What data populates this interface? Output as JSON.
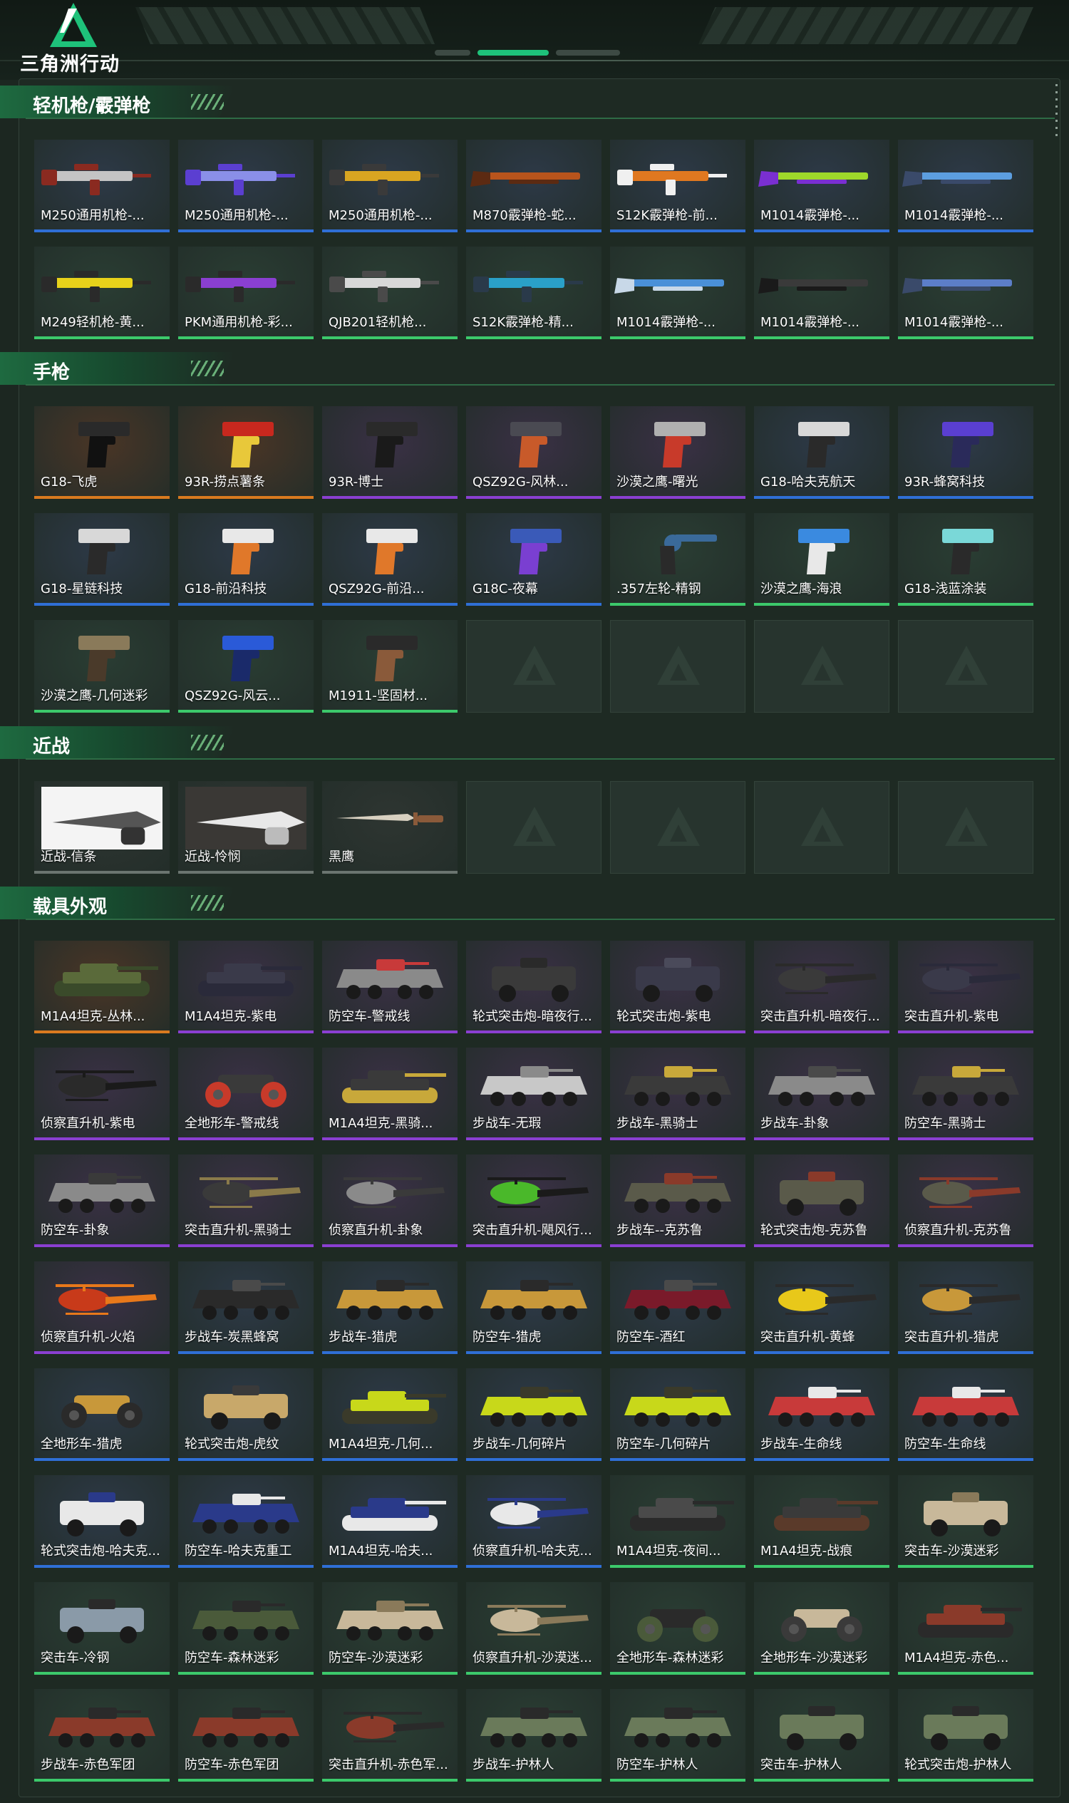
{
  "header": {
    "logo_text": "三角洲行动",
    "colors": {
      "accent": "#1ec27a",
      "brand_green": "#1e6a40"
    }
  },
  "rarity_colors": {
    "orange": "#d97a1f",
    "purple": "#8a3fd1",
    "blue": "#2f6fd6",
    "green": "#3cc96b",
    "gray": "#6b7570"
  },
  "sections": {
    "lmg": {
      "title": "轻机枪/霰弹枪",
      "items": [
        {
          "name": "M250通用机枪-...",
          "rarity": "blue",
          "kind": "rifle",
          "colors": [
            "#c4c4c4",
            "#8a2a20"
          ]
        },
        {
          "name": "M250通用机枪-...",
          "rarity": "blue",
          "kind": "rifle",
          "colors": [
            "#8a8fe8",
            "#5b3fd1"
          ]
        },
        {
          "name": "M250通用机枪-...",
          "rarity": "blue",
          "kind": "rifle",
          "colors": [
            "#d9a521",
            "#3a3a3a"
          ]
        },
        {
          "name": "M870霰弹枪-蛇...",
          "rarity": "blue",
          "kind": "shotgun",
          "colors": [
            "#b8541c",
            "#5c2a12"
          ]
        },
        {
          "name": "S12K霰弹枪-前...",
          "rarity": "blue",
          "kind": "rifle",
          "colors": [
            "#e07820",
            "#f0f0f0"
          ]
        },
        {
          "name": "M1014霰弹枪-...",
          "rarity": "blue",
          "kind": "shotgun",
          "colors": [
            "#9ed82a",
            "#7a2fd1"
          ]
        },
        {
          "name": "M1014霰弹枪-...",
          "rarity": "blue",
          "kind": "shotgun",
          "colors": [
            "#5c9ee0",
            "#3a4a6a"
          ]
        },
        {
          "name": "M249轻机枪-黄...",
          "rarity": "green",
          "kind": "rifle",
          "colors": [
            "#e8d21a",
            "#2a2a2a"
          ]
        },
        {
          "name": "PKM通用机枪-彩...",
          "rarity": "green",
          "kind": "rifle",
          "colors": [
            "#8a3fd1",
            "#2a2a2a"
          ]
        },
        {
          "name": "QJB201轻机枪...",
          "rarity": "green",
          "kind": "rifle",
          "colors": [
            "#d8d8d8",
            "#4a4a4a"
          ]
        },
        {
          "name": "S12K霰弹枪-精...",
          "rarity": "green",
          "kind": "rifle",
          "colors": [
            "#2aa0c8",
            "#2a3a4a"
          ]
        },
        {
          "name": "M1014霰弹枪-...",
          "rarity": "green",
          "kind": "shotgun",
          "colors": [
            "#4a90d8",
            "#c8d8e8"
          ]
        },
        {
          "name": "M1014霰弹枪-...",
          "rarity": "green",
          "kind": "shotgun",
          "colors": [
            "#3a3a3a",
            "#1a1a1a"
          ]
        },
        {
          "name": "M1014霰弹枪-...",
          "rarity": "green",
          "kind": "shotgun",
          "colors": [
            "#5c7ec8",
            "#3a4a6a"
          ]
        }
      ]
    },
    "pistol": {
      "title": "手枪",
      "items": [
        {
          "name": "G18-飞虎",
          "rarity": "orange",
          "kind": "pistol",
          "colors": [
            "#2a2a2a",
            "#111111"
          ]
        },
        {
          "name": "93R-捞点薯条",
          "rarity": "orange",
          "kind": "pistol",
          "colors": [
            "#c8281e",
            "#e8c83a"
          ]
        },
        {
          "name": "93R-博士",
          "rarity": "purple",
          "kind": "pistol",
          "colors": [
            "#2a2a2a",
            "#1a1a1a"
          ]
        },
        {
          "name": "QSZ92G-风林...",
          "rarity": "purple",
          "kind": "pistol",
          "colors": [
            "#4a4a52",
            "#c85a2a"
          ]
        },
        {
          "name": "沙漠之鹰-曙光",
          "rarity": "purple",
          "kind": "pistol",
          "colors": [
            "#b0b0b0",
            "#c83a2a"
          ]
        },
        {
          "name": "G18-哈夫克航天",
          "rarity": "blue",
          "kind": "pistol",
          "colors": [
            "#d8d8d8",
            "#2a2a2a"
          ]
        },
        {
          "name": "93R-蜂窝科技",
          "rarity": "blue",
          "kind": "pistol",
          "colors": [
            "#5a3fd1",
            "#2a2a5a"
          ]
        },
        {
          "name": "G18-星链科技",
          "rarity": "blue",
          "kind": "pistol",
          "colors": [
            "#d8d8d8",
            "#2a2a2a"
          ]
        },
        {
          "name": "G18-前沿科技",
          "rarity": "blue",
          "kind": "pistol",
          "colors": [
            "#e8e8e8",
            "#e0782a"
          ]
        },
        {
          "name": "QSZ92G-前沿...",
          "rarity": "blue",
          "kind": "pistol",
          "colors": [
            "#e8e8e8",
            "#e0782a"
          ]
        },
        {
          "name": "G18C-夜幕",
          "rarity": "blue",
          "kind": "pistol",
          "colors": [
            "#3a5ab8",
            "#7a3fd1"
          ]
        },
        {
          ".name": "",
          "name": ".357左轮-精钢",
          "rarity": "green",
          "kind": "revolver",
          "colors": [
            "#3a6a9a",
            "#2a2a2a"
          ]
        },
        {
          "name": "沙漠之鹰-海浪",
          "rarity": "green",
          "kind": "pistol",
          "colors": [
            "#3a8ae0",
            "#e8e8e8"
          ]
        },
        {
          "name": "G18-浅蓝涂装",
          "rarity": "green",
          "kind": "pistol",
          "colors": [
            "#7ad8d8",
            "#2a2a2a"
          ]
        },
        {
          "name": "沙漠之鹰-几何迷彩",
          "rarity": "green",
          "kind": "pistol",
          "colors": [
            "#8a7a5a",
            "#4a3a2a"
          ]
        },
        {
          "name": "QSZ92G-风云...",
          "rarity": "green",
          "kind": "pistol",
          "colors": [
            "#2a5ad8",
            "#1a2a6a"
          ]
        },
        {
          "name": "M1911-坚固材...",
          "rarity": "green",
          "kind": "pistol",
          "colors": [
            "#2a2a2a",
            "#8a5a3a"
          ]
        },
        {
          "empty": true
        },
        {
          "empty": true
        },
        {
          "empty": true
        },
        {
          "empty": true
        }
      ]
    },
    "melee": {
      "title": "近战",
      "items": [
        {
          "name": "近战-信条",
          "rarity": "gray",
          "kind": "photo",
          "photo": "light"
        },
        {
          "name": "近战-怜悯",
          "rarity": "gray",
          "kind": "photo",
          "photo": "dark"
        },
        {
          "name": "黑鹰",
          "rarity": "gray",
          "kind": "knife",
          "colors": [
            "#d8d0c0",
            "#8a5a3a"
          ]
        },
        {
          "empty": true
        },
        {
          "empty": true
        },
        {
          "empty": true
        },
        {
          "empty": true
        }
      ]
    },
    "vehicle": {
      "title": "载具外观",
      "items": [
        {
          "name": "M1A4坦克-丛林...",
          "rarity": "orange",
          "kind": "tank",
          "colors": [
            "#5a6a3a",
            "#3a4a2a"
          ]
        },
        {
          "name": "M1A4坦克-紫电",
          "rarity": "purple",
          "kind": "tank",
          "colors": [
            "#3a3a4a",
            "#2a2a3a"
          ]
        },
        {
          "name": "防空车-警戒线",
          "rarity": "purple",
          "kind": "apc",
          "colors": [
            "#8a8a8a",
            "#c83a3a"
          ]
        },
        {
          "name": "轮式突击炮-暗夜行...",
          "rarity": "purple",
          "kind": "truck",
          "colors": [
            "#3a3a3a",
            "#2a2a2a"
          ]
        },
        {
          "name": "轮式突击炮-紫电",
          "rarity": "purple",
          "kind": "truck",
          "colors": [
            "#3a3a4a",
            "#4a4a5a"
          ]
        },
        {
          "name": "突击直升机-暗夜行...",
          "rarity": "purple",
          "kind": "heli",
          "colors": [
            "#3a3a3a",
            "#2a2a2a"
          ]
        },
        {
          "name": "突击直升机-紫电",
          "rarity": "purple",
          "kind": "heli",
          "colors": [
            "#3a3a4a",
            "#2a2a3a"
          ]
        },
        {
          "name": "侦察直升机-紫电",
          "rarity": "purple",
          "kind": "heli",
          "colors": [
            "#2a2a2a",
            "#1a1a1a"
          ]
        },
        {
          "name": "全地形车-警戒线",
          "rarity": "purple",
          "kind": "atv",
          "colors": [
            "#3a3a3a",
            "#c83a2a"
          ]
        },
        {
          "name": "M1A4坦克-黑骑...",
          "rarity": "purple",
          "kind": "tank",
          "colors": [
            "#3a3a3a",
            "#c8a83a"
          ]
        },
        {
          "name": "步战车-无瑕",
          "rarity": "purple",
          "kind": "apc",
          "colors": [
            "#c8c8c8",
            "#8a8a8a"
          ]
        },
        {
          "name": "步战车-黑骑士",
          "rarity": "purple",
          "kind": "apc",
          "colors": [
            "#3a3a3a",
            "#c8a83a"
          ]
        },
        {
          "name": "步战车-卦象",
          "rarity": "purple",
          "kind": "apc",
          "colors": [
            "#8a8a8a",
            "#4a4a4a"
          ]
        },
        {
          "name": "防空车-黑骑士",
          "rarity": "purple",
          "kind": "apc",
          "colors": [
            "#3a3a3a",
            "#c8a83a"
          ]
        },
        {
          "name": "防空车-卦象",
          "rarity": "purple",
          "kind": "apc",
          "colors": [
            "#8a8a8a",
            "#3a3a3a"
          ]
        },
        {
          "name": "突击直升机-黑骑士",
          "rarity": "purple",
          "kind": "heli",
          "colors": [
            "#3a3a3a",
            "#8a7a4a"
          ]
        },
        {
          "name": "侦察直升机-卦象",
          "rarity": "purple",
          "kind": "heli",
          "colors": [
            "#8a8a8a",
            "#3a3a3a"
          ]
        },
        {
          "name": "突击直升机-飓风行...",
          "rarity": "purple",
          "kind": "heli",
          "colors": [
            "#4ab82a",
            "#1a1a1a"
          ]
        },
        {
          "name": "步战车--克苏鲁",
          "rarity": "purple",
          "kind": "apc",
          "colors": [
            "#5a5a4a",
            "#8a3a2a"
          ]
        },
        {
          "name": "轮式突击炮-克苏鲁",
          "rarity": "purple",
          "kind": "truck",
          "colors": [
            "#5a5a4a",
            "#8a3a2a"
          ]
        },
        {
          "name": "侦察直升机-克苏鲁",
          "rarity": "purple",
          "kind": "heli",
          "colors": [
            "#5a5a4a",
            "#8a3a2a"
          ]
        },
        {
          "name": "侦察直升机-火焰",
          "rarity": "purple",
          "kind": "heli",
          "colors": [
            "#c83a1a",
            "#e8781a"
          ]
        },
        {
          "name": "步战车-炭黑蜂窝",
          "rarity": "blue",
          "kind": "apc",
          "colors": [
            "#2a2a2a",
            "#4a4a4a"
          ]
        },
        {
          "name": "步战车-猎虎",
          "rarity": "blue",
          "kind": "apc",
          "colors": [
            "#c8983a",
            "#2a2a2a"
          ]
        },
        {
          "name": "防空车-猎虎",
          "rarity": "blue",
          "kind": "apc",
          "colors": [
            "#c8983a",
            "#2a2a2a"
          ]
        },
        {
          "name": "防空车-酒红",
          "rarity": "blue",
          "kind": "apc",
          "colors": [
            "#7a1a2a",
            "#4a4a4a"
          ]
        },
        {
          "name": "突击直升机-黄蜂",
          "rarity": "blue",
          "kind": "heli",
          "colors": [
            "#e8c81a",
            "#2a2a2a"
          ]
        },
        {
          "name": "突击直升机-猎虎",
          "rarity": "blue",
          "kind": "heli",
          "colors": [
            "#c8983a",
            "#2a2a2a"
          ]
        },
        {
          "name": "全地形车-猎虎",
          "rarity": "blue",
          "kind": "atv",
          "colors": [
            "#c8983a",
            "#2a2a2a"
          ]
        },
        {
          "name": "轮式突击炮-虎纹",
          "rarity": "blue",
          "kind": "truck",
          "colors": [
            "#c8a86a",
            "#3a3a3a"
          ]
        },
        {
          "name": "M1A4坦克-几何...",
          "rarity": "blue",
          "kind": "tank",
          "colors": [
            "#c8d81a",
            "#3a3a2a"
          ]
        },
        {
          "name": "步战车-几何碎片",
          "rarity": "blue",
          "kind": "apc",
          "colors": [
            "#c8d81a",
            "#3a3a2a"
          ]
        },
        {
          "name": "防空车-几何碎片",
          "rarity": "blue",
          "kind": "apc",
          "colors": [
            "#c8d81a",
            "#3a3a2a"
          ]
        },
        {
          "name": "步战车-生命线",
          "rarity": "blue",
          "kind": "apc",
          "colors": [
            "#c83a3a",
            "#e8e8e8"
          ]
        },
        {
          "name": "防空车-生命线",
          "rarity": "blue",
          "kind": "apc",
          "colors": [
            "#c83a3a",
            "#e8e8e8"
          ]
        },
        {
          "name": "轮式突击炮-哈夫克...",
          "rarity": "blue",
          "kind": "truck",
          "colors": [
            "#e8e8e8",
            "#2a3a8a"
          ]
        },
        {
          "name": "防空车-哈夫克重工",
          "rarity": "blue",
          "kind": "apc",
          "colors": [
            "#2a3a8a",
            "#e8e8e8"
          ]
        },
        {
          "name": "M1A4坦克-哈夫...",
          "rarity": "blue",
          "kind": "tank",
          "colors": [
            "#2a3a8a",
            "#e8e8e8"
          ]
        },
        {
          "name": "侦察直升机-哈夫克...",
          "rarity": "blue",
          "kind": "heli",
          "colors": [
            "#e8e8e8",
            "#2a3a8a"
          ]
        },
        {
          "name": "M1A4坦克-夜间...",
          "rarity": "green",
          "kind": "tank",
          "colors": [
            "#4a4a4a",
            "#2a2a2a"
          ]
        },
        {
          "name": "M1A4坦克-战痕",
          "rarity": "green",
          "kind": "tank",
          "colors": [
            "#3a3a3a",
            "#5a3a2a"
          ]
        },
        {
          "name": "突击车-沙漠迷彩",
          "rarity": "green",
          "kind": "truck",
          "colors": [
            "#c8b89a",
            "#8a7a5a"
          ]
        },
        {
          "name": "突击车-冷钢",
          "rarity": "green",
          "kind": "truck",
          "colors": [
            "#8a9aa8",
            "#2a2a2a"
          ]
        },
        {
          "name": "防空车-森林迷彩",
          "rarity": "green",
          "kind": "apc",
          "colors": [
            "#4a5a3a",
            "#2a2a2a"
          ]
        },
        {
          "name": "防空车-沙漠迷彩",
          "rarity": "green",
          "kind": "apc",
          "colors": [
            "#c8b89a",
            "#8a7a5a"
          ]
        },
        {
          "name": "侦察直升机-沙漠迷...",
          "rarity": "green",
          "kind": "heli",
          "colors": [
            "#c8b89a",
            "#8a7a5a"
          ]
        },
        {
          "name": "全地形车-森林迷彩",
          "rarity": "green",
          "kind": "atv",
          "colors": [
            "#2a2a2a",
            "#4a5a3a"
          ]
        },
        {
          "name": "全地形车-沙漠迷彩",
          "rarity": "green",
          "kind": "atv",
          "colors": [
            "#c8b89a",
            "#3a3a3a"
          ]
        },
        {
          "name": "M1A4坦克-赤色...",
          "rarity": "green",
          "kind": "tank",
          "colors": [
            "#8a3a2a",
            "#2a2a2a"
          ]
        },
        {
          "name": "步战车-赤色军团",
          "rarity": "green",
          "kind": "apc",
          "colors": [
            "#8a3a2a",
            "#2a2a2a"
          ]
        },
        {
          "name": "防空车-赤色军团",
          "rarity": "green",
          "kind": "apc",
          "colors": [
            "#8a3a2a",
            "#2a2a2a"
          ]
        },
        {
          "name": "突击直升机-赤色军...",
          "rarity": "green",
          "kind": "heli",
          "colors": [
            "#8a3a2a",
            "#2a2a2a"
          ]
        },
        {
          "name": "步战车-护林人",
          "rarity": "green",
          "kind": "apc",
          "colors": [
            "#6a7a5a",
            "#2a2a2a"
          ]
        },
        {
          "name": "防空车-护林人",
          "rarity": "green",
          "kind": "apc",
          "colors": [
            "#6a7a5a",
            "#2a2a2a"
          ]
        },
        {
          "name": "突击车-护林人",
          "rarity": "green",
          "kind": "truck",
          "colors": [
            "#6a7a5a",
            "#2a2a2a"
          ]
        },
        {
          "name": "轮式突击炮-护林人",
          "rarity": "green",
          "kind": "truck",
          "colors": [
            "#6a7a5a",
            "#2a2a2a"
          ]
        }
      ]
    }
  }
}
